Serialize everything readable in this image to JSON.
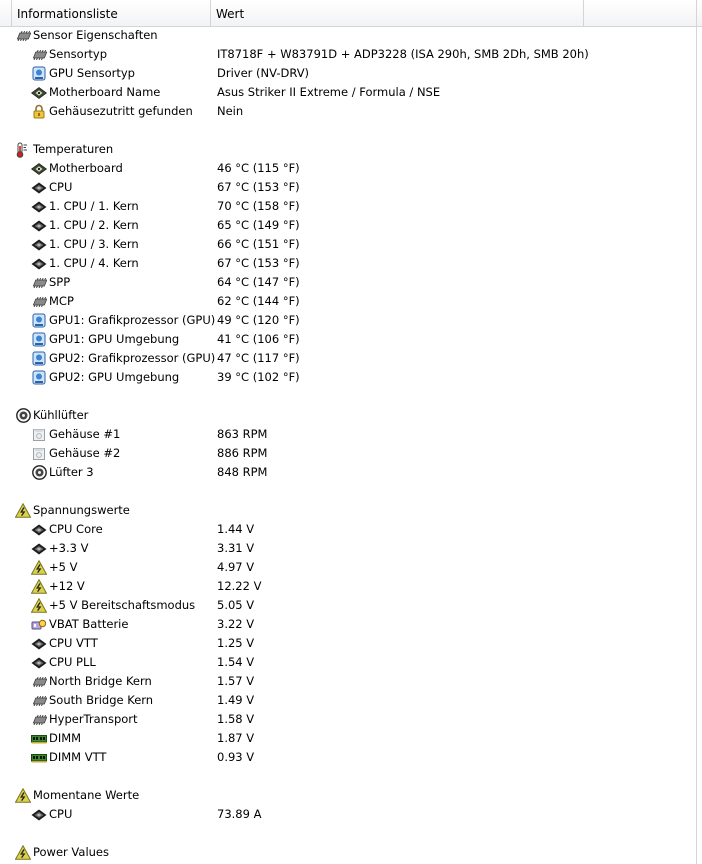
{
  "header": {
    "col_info": "Informationsliste",
    "col_value": "Wert"
  },
  "groups": [
    {
      "title": "Sensor Eigenschaften",
      "icon": "chip-icon",
      "items": [
        {
          "label": "Sensortyp",
          "value": "IT8718F + W83791D + ADP3228  (ISA 290h, SMB 2Dh, SMB 20h)",
          "icon": "chip-icon"
        },
        {
          "label": "GPU Sensortyp",
          "value": "Driver  (NV-DRV)",
          "icon": "gpu-icon"
        },
        {
          "label": "Motherboard Name",
          "value": "Asus Striker II Extreme / Formula / NSE",
          "icon": "motherboard-icon"
        },
        {
          "label": "Gehäusezutritt gefunden",
          "value": "Nein",
          "icon": "lock-icon"
        }
      ]
    },
    {
      "title": "Temperaturen",
      "icon": "thermometer-icon",
      "items": [
        {
          "label": "Motherboard",
          "value": "46 °C  (115 °F)",
          "icon": "motherboard-icon"
        },
        {
          "label": "CPU",
          "value": "67 °C  (153 °F)",
          "icon": "cpu-icon"
        },
        {
          "label": "1. CPU / 1. Kern",
          "value": "70 °C  (158 °F)",
          "icon": "cpu-icon"
        },
        {
          "label": "1. CPU / 2. Kern",
          "value": "65 °C  (149 °F)",
          "icon": "cpu-icon"
        },
        {
          "label": "1. CPU / 3. Kern",
          "value": "66 °C  (151 °F)",
          "icon": "cpu-icon"
        },
        {
          "label": "1. CPU / 4. Kern",
          "value": "67 °C  (153 °F)",
          "icon": "cpu-icon"
        },
        {
          "label": "SPP",
          "value": "64 °C  (147 °F)",
          "icon": "chip-icon"
        },
        {
          "label": "MCP",
          "value": "62 °C  (144 °F)",
          "icon": "chip-icon"
        },
        {
          "label": "GPU1: Grafikprozessor (GPU)",
          "value": "49 °C  (120 °F)",
          "icon": "gpu-icon"
        },
        {
          "label": "GPU1: GPU Umgebung",
          "value": "41 °C  (106 °F)",
          "icon": "gpu-icon"
        },
        {
          "label": "GPU2: Grafikprozessor (GPU)",
          "value": "47 °C  (117 °F)",
          "icon": "gpu-icon"
        },
        {
          "label": "GPU2: GPU Umgebung",
          "value": "39 °C  (102 °F)",
          "icon": "gpu-icon"
        }
      ]
    },
    {
      "title": "Kühllüfter",
      "icon": "fan-icon",
      "items": [
        {
          "label": "Gehäuse #1",
          "value": "863 RPM",
          "icon": "case-icon"
        },
        {
          "label": "Gehäuse #2",
          "value": "886 RPM",
          "icon": "case-icon"
        },
        {
          "label": "Lüfter 3",
          "value": "848 RPM",
          "icon": "fan-icon"
        }
      ]
    },
    {
      "title": "Spannungswerte",
      "icon": "voltage-icon",
      "items": [
        {
          "label": "CPU Core",
          "value": "1.44 V",
          "icon": "cpu-icon"
        },
        {
          "label": "+3.3 V",
          "value": "3.31 V",
          "icon": "cpu-icon"
        },
        {
          "label": "+5 V",
          "value": "4.97 V",
          "icon": "voltage-icon"
        },
        {
          "label": "+12 V",
          "value": "12.22 V",
          "icon": "voltage-icon"
        },
        {
          "label": "+5 V Bereitschaftsmodus",
          "value": "5.05 V",
          "icon": "voltage-icon"
        },
        {
          "label": "VBAT Batterie",
          "value": "3.22 V",
          "icon": "battery-icon"
        },
        {
          "label": "CPU VTT",
          "value": "1.25 V",
          "icon": "cpu-icon"
        },
        {
          "label": "CPU PLL",
          "value": "1.54 V",
          "icon": "cpu-icon"
        },
        {
          "label": "North Bridge Kern",
          "value": "1.57 V",
          "icon": "chip-icon"
        },
        {
          "label": "South Bridge Kern",
          "value": "1.49 V",
          "icon": "chip-icon"
        },
        {
          "label": "HyperTransport",
          "value": "1.58 V",
          "icon": "chip-icon"
        },
        {
          "label": "DIMM",
          "value": "1.87 V",
          "icon": "dimm-icon"
        },
        {
          "label": "DIMM VTT",
          "value": "0.93 V",
          "icon": "dimm-icon"
        }
      ]
    },
    {
      "title": "Momentane Werte",
      "icon": "voltage-icon",
      "items": [
        {
          "label": "CPU",
          "value": "73.89 A",
          "icon": "cpu-icon"
        }
      ]
    },
    {
      "title": "Power Values",
      "icon": "voltage-icon",
      "items": []
    }
  ]
}
